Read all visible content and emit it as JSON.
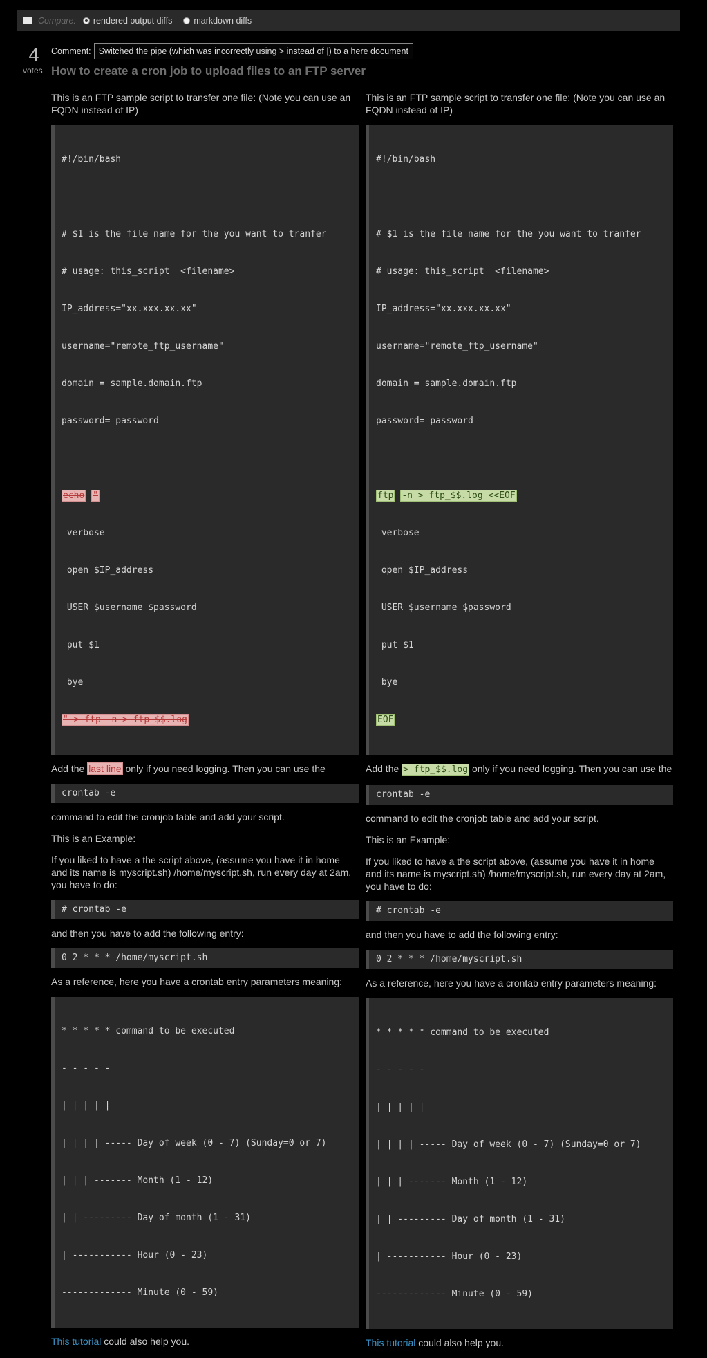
{
  "compare": {
    "label": "Compare:",
    "option_rendered": "rendered output diffs",
    "option_markdown": "markdown diffs"
  },
  "votes": {
    "count": "4",
    "label": "votes"
  },
  "comment": {
    "label": "Comment:",
    "text": "Switched the pipe (which was incorrectly using > instead of |) to a here document"
  },
  "title": "How to create a cron job to upload files to an FTP server",
  "left": {
    "intro": "This is an FTP sample script to transfer one file: (Note you can use an FQDN instead of IP)",
    "script_lines": [
      "#!/bin/bash",
      "",
      "# $1 is the file name for the you want to tranfer",
      "# usage: this_script  <filename>",
      "IP_address=\"xx.xxx.xx.xx\"",
      "username=\"remote_ftp_username\"",
      "domain = sample.domain.ftp",
      "password= password",
      ""
    ],
    "del_echo": "echo",
    "del_quote": "\"",
    "body_lines": [
      " verbose",
      " open $IP_address",
      " USER $username $password",
      " put $1",
      " bye"
    ],
    "del_last": "\" > ftp -n > ftp_$$.log",
    "add_pre": "Add the",
    "add_del": "last line",
    "add_post": "only if you need logging. Then you can use the",
    "crontab_cmd": "crontab -e",
    "edit_text": "command to edit the cronjob table and add your script.",
    "example_label": "This is an Example:",
    "example_text": "If you liked to have a the script above, (assume you have it in home and its name is myscript.sh) /home/myscript.sh, run every day at 2am, you have to do:",
    "crontab_root": "# crontab -e",
    "entry_text": "and then you have to add the following entry:",
    "entry_code": "0 2 * * * /home/myscript.sh",
    "reference_text": "As a reference, here you have a crontab entry parameters meaning:",
    "reference_lines": [
      "* * * * * command to be executed",
      "- - - - -",
      "| | | | |",
      "| | | | ----- Day of week (0 - 7) (Sunday=0 or 7)",
      "| | | ------- Month (1 - 12)",
      "| | --------- Day of month (1 - 31)",
      "| ----------- Hour (0 - 23)",
      "------------- Minute (0 - 59)"
    ],
    "tutorial_link": "This tutorial",
    "tutorial_rest": " could also help you."
  },
  "right": {
    "intro": "This is an FTP sample script to transfer one file: (Note you can use an FQDN instead of IP)",
    "script_lines": [
      "#!/bin/bash",
      "",
      "# $1 is the file name for the you want to tranfer",
      "# usage: this_script  <filename>",
      "IP_address=\"xx.xxx.xx.xx\"",
      "username=\"remote_ftp_username\"",
      "domain = sample.domain.ftp",
      "password= password",
      ""
    ],
    "ins_ftp": "ftp",
    "ins_rest": "-n > ftp_$$.log <<EOF",
    "body_lines": [
      " verbose",
      " open $IP_address",
      " USER $username $password",
      " put $1",
      " bye"
    ],
    "ins_eof": "EOF",
    "add_pre": "Add the",
    "add_ins": "> ftp_$$.log",
    "add_post": "only if you need logging. Then you can use the",
    "crontab_cmd": "crontab -e",
    "edit_text": "command to edit the cronjob table and add your script.",
    "example_label": "This is an Example:",
    "example_text": "If you liked to have a the script above, (assume you have it in home and its name is myscript.sh) /home/myscript.sh, run every day at 2am, you have to do:",
    "crontab_root": "# crontab -e",
    "entry_text": "and then you have to add the following entry:",
    "entry_code": "0 2 * * * /home/myscript.sh",
    "reference_text": "As a reference, here you have a crontab entry parameters meaning:",
    "reference_lines": [
      "* * * * * command to be executed",
      "- - - - -",
      "| | | | |",
      "| | | | ----- Day of week (0 - 7) (Sunday=0 or 7)",
      "| | | ------- Month (1 - 12)",
      "| | --------- Day of month (1 - 31)",
      "| ----------- Hour (0 - 23)",
      "------------- Minute (0 - 59)"
    ],
    "tutorial_link": "This tutorial",
    "tutorial_rest": " could also help you."
  }
}
